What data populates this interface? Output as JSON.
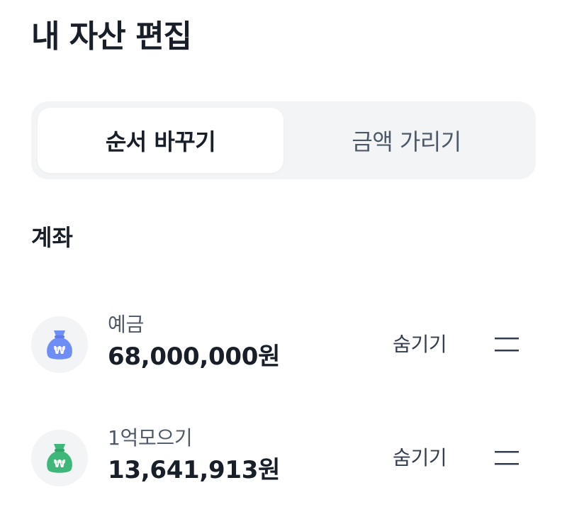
{
  "header": {
    "title": "내 자산 편집"
  },
  "tabs": [
    {
      "label": "순서 바꾸기",
      "active": true
    },
    {
      "label": "금액 가리기",
      "active": false
    }
  ],
  "section": {
    "title": "계좌"
  },
  "accounts": [
    {
      "name": "예금",
      "amount": "68,000,000원",
      "hide_label": "숨기기",
      "icon": "money-bag-icon",
      "icon_color": "#6f8ef5"
    },
    {
      "name": "1억모으기",
      "amount": "13,641,913원",
      "hide_label": "숨기기",
      "icon": "money-bag-icon",
      "icon_color": "#3fb67a"
    }
  ]
}
